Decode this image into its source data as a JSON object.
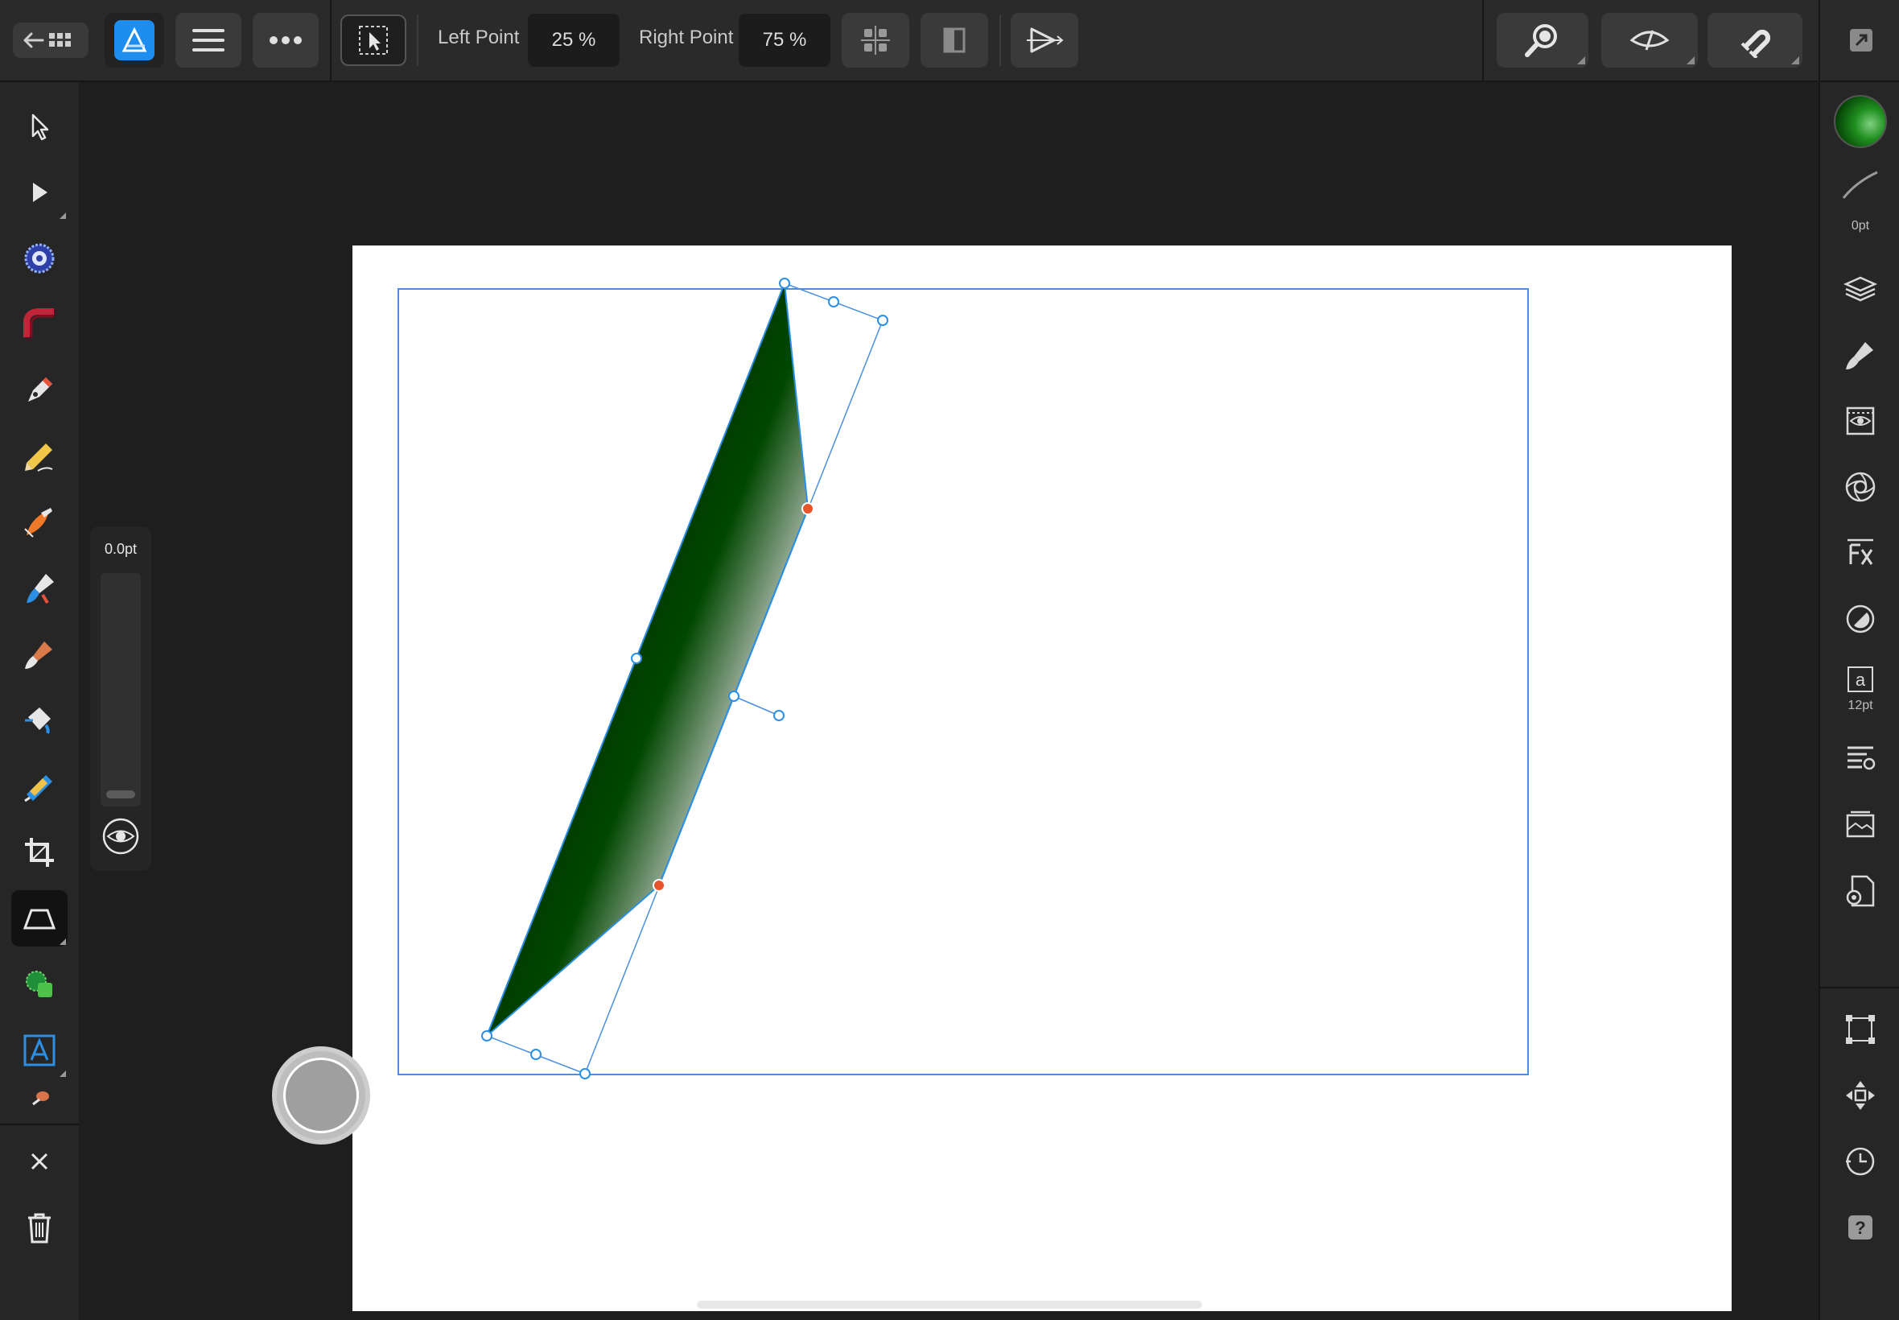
{
  "toolbar": {
    "left_point_label": "Left Point",
    "left_point_value": "25 %",
    "right_point_label": "Right Point",
    "right_point_value": "75 %"
  },
  "left_tools": [
    "move-tool",
    "node-tool",
    "corner-tool",
    "point-transform-tool",
    "pen-tool",
    "pencil-tool",
    "vector-brush-tool",
    "fill-tool",
    "paint-brush-tool",
    "color-picker-tool",
    "transparency-tool",
    "crop-tool",
    "shape-tool",
    "contour-tool",
    "artistic-text-tool"
  ],
  "right_studio": {
    "stroke_width_label": "0pt",
    "text_size_label": "12pt"
  },
  "stroke_panel": {
    "value": "0.0pt"
  },
  "colors": {
    "accent": "#2b8fe6",
    "selection": "#4a90e2",
    "gradient_dark": "#003300",
    "gradient_light": "#d2d2d2",
    "node_active": "#e8552a"
  }
}
